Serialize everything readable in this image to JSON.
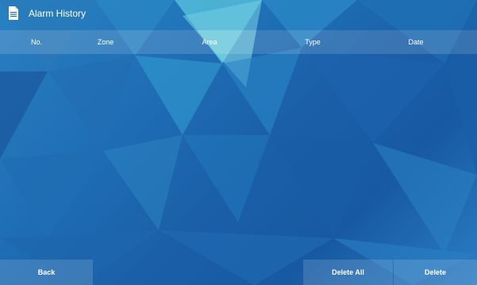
{
  "window": {
    "title": "Alarm History",
    "title_icon": "document-icon"
  },
  "table": {
    "headers": [
      "No.",
      "Zone",
      "Area",
      "Type",
      "Date"
    ],
    "rows": []
  },
  "buttons": {
    "back": "Back",
    "delete_all": "Delete All",
    "delete": "Delete"
  },
  "colors": {
    "background_base": "#1f6fb6",
    "text": "#ffffff"
  }
}
